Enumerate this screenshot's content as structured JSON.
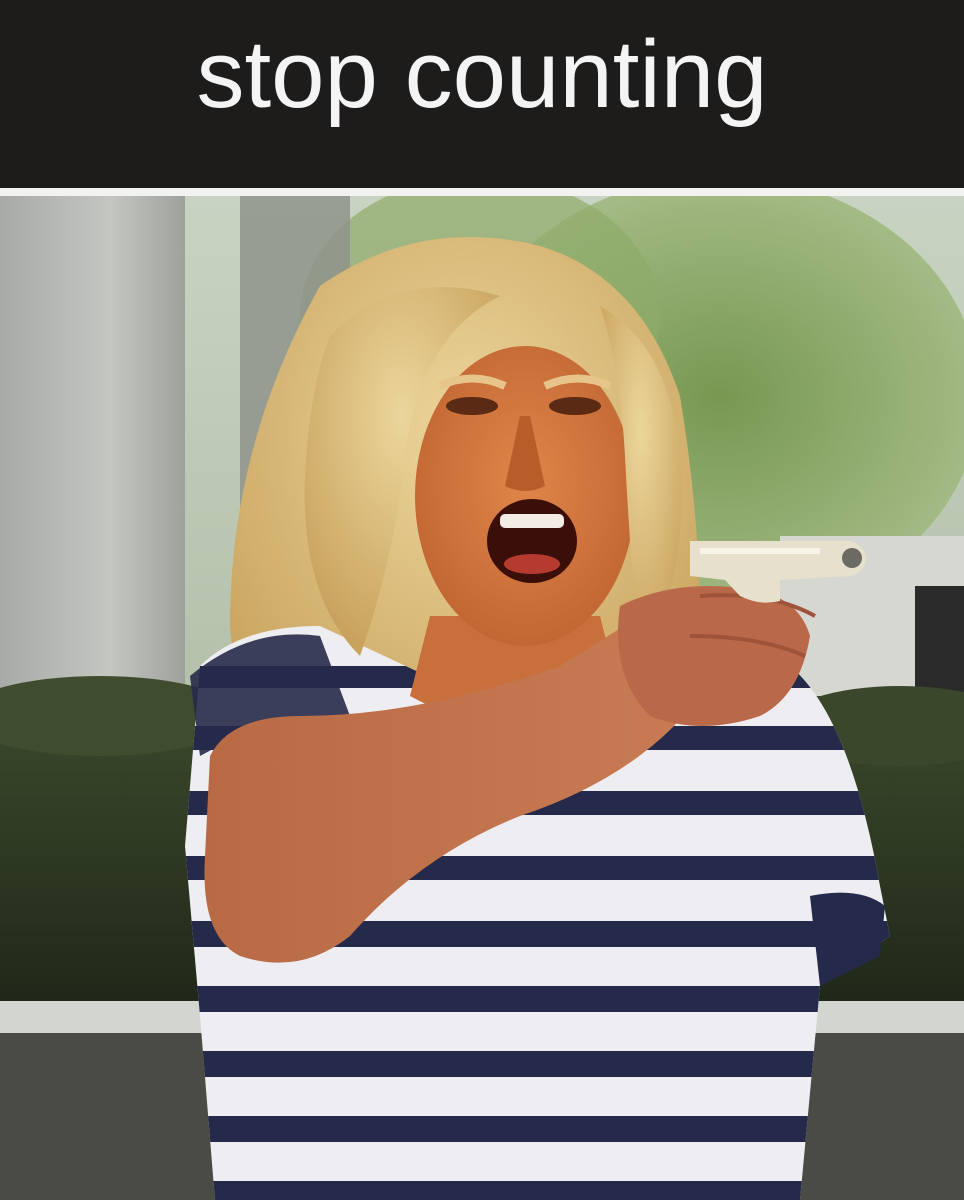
{
  "caption": {
    "text": "stop counting"
  },
  "photo": {
    "alt": "",
    "icon": "photo-illustration"
  },
  "colors": {
    "caption_bar": "#1e1c1a",
    "caption_text": "#f4f4f4",
    "shirt_stripe_navy": "#262a4a",
    "shirt_stripe_white": "#eeeef2",
    "hair_blonde": "#d9bd7a",
    "skin_orange": "#d97a3c",
    "hedge": "#2f3a24",
    "foliage": "#7fa05a"
  }
}
